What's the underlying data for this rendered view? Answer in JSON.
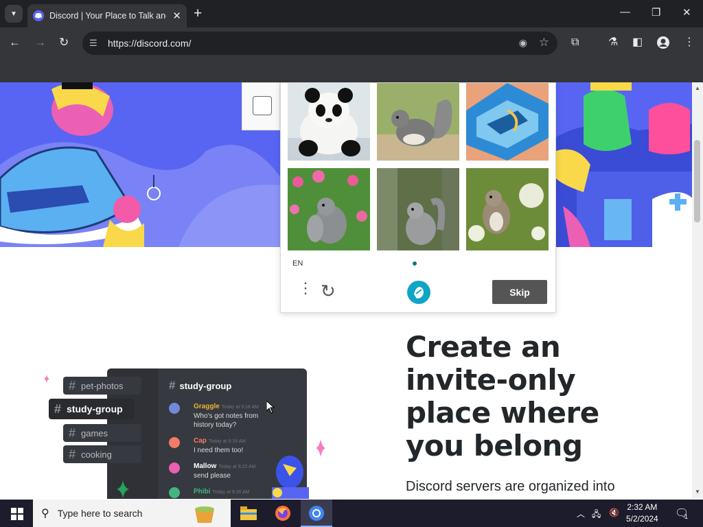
{
  "browser": {
    "tab_title": "Discord | Your Place to Talk and",
    "url": "https://discord.com/",
    "new_tab_icon": "plus-icon",
    "window_controls": [
      "minimize-icon",
      "restore-icon",
      "close-icon"
    ]
  },
  "captcha": {
    "lang": "EN",
    "skip_label": "Skip",
    "tiles": [
      "panda",
      "squirrel",
      "painting",
      "squirrel",
      "squirrel",
      "squirrel"
    ]
  },
  "channels": [
    {
      "label": "pet-photos"
    },
    {
      "label": "study-group"
    },
    {
      "label": "games"
    },
    {
      "label": "cooking"
    }
  ],
  "chat": {
    "header": "study-group",
    "messages": [
      {
        "name": "Graggle",
        "time": "Today at 9:18 AM",
        "text1": "Who's got notes from",
        "text2": "history today?",
        "color": "#f0b232"
      },
      {
        "name": "Cap",
        "time": "Today at 9:19 AM",
        "text1": "I need them too!",
        "text2": "",
        "color": "#f47b67"
      },
      {
        "name": "Mallow",
        "time": "Today at 9:22 AM",
        "text1": "send please",
        "text2": "",
        "color": "#ffffff"
      },
      {
        "name": "Phibi",
        "time": "Today at 9:30 AM",
        "text1": "",
        "text2": "",
        "color": "#43b581"
      }
    ]
  },
  "hero": {
    "headline1": "Create an",
    "headline2": "invite-only",
    "headline3": "place where",
    "headline4": "you belong",
    "body": "Discord servers are organized into"
  },
  "taskbar": {
    "search_placeholder": "Type here to search",
    "time": "2:32 AM",
    "date": "5/2/2024",
    "notification_count": "1"
  }
}
